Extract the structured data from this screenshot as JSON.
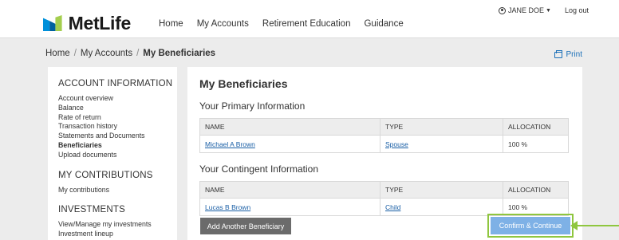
{
  "header": {
    "brand": "MetLife",
    "nav": [
      "Home",
      "My Accounts",
      "Retirement Education",
      "Guidance"
    ],
    "user_name": "JANE DOE",
    "logout": "Log out"
  },
  "breadcrumb": {
    "home": "Home",
    "accounts": "My Accounts",
    "current": "My Beneficiaries",
    "sep": "/"
  },
  "print_label": "Print",
  "sidebar": {
    "sections": [
      {
        "title": "ACCOUNT INFORMATION",
        "items": [
          "Account overview",
          "Balance",
          "Rate of return",
          "Transaction history",
          "Statements and Documents",
          "Beneficiaries",
          "Upload documents"
        ]
      },
      {
        "title": "MY CONTRIBUTIONS",
        "items": [
          "My contributions"
        ]
      },
      {
        "title": "INVESTMENTS",
        "items": [
          "View/Manage my investments",
          "Investment lineup"
        ]
      }
    ],
    "active_item": "Beneficiaries"
  },
  "main": {
    "title": "My Beneficiaries",
    "primary": {
      "heading": "Your Primary Information",
      "columns": [
        "NAME",
        "TYPE",
        "ALLOCATION"
      ],
      "rows": [
        {
          "name": "Michael A Brown",
          "type": "Spouse",
          "allocation": "100 %"
        }
      ]
    },
    "contingent": {
      "heading": "Your Contingent Information",
      "columns": [
        "NAME",
        "TYPE",
        "ALLOCATION"
      ],
      "rows": [
        {
          "name": "Lucas B Brown",
          "type": "Child",
          "allocation": "100 %"
        }
      ]
    },
    "add_button": "Add Another Beneficiary",
    "confirm_button": "Confirm & Continue"
  },
  "colors": {
    "brand_blue": "#0090da",
    "brand_green": "#a4ce4e",
    "link": "#1a5fa6",
    "highlight": "#8fc63f",
    "confirm_bg": "#7eb1e6"
  }
}
